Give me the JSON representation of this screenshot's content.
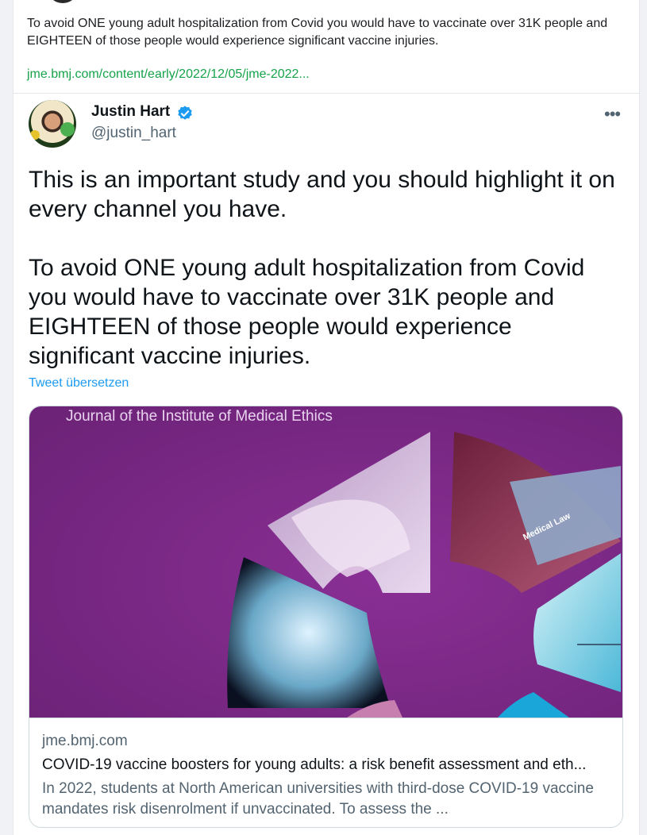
{
  "post": {
    "text": "To avoid ONE young adult hospitalization from Covid you would have to vaccinate over 31K people and EIGHTEEN of those people would experience significant vaccine injuries.",
    "link": "jme.bmj.com/content/early/2022/12/05/jme-2022..."
  },
  "tweet": {
    "author_name": "Justin Hart",
    "author_handle": "@justin_hart",
    "more_icon": "•••",
    "body": "This is an important study and you should highlight it on every channel you have.\n\nTo avoid ONE young adult hospitalization from Covid you would have to vaccinate over 31K people and EIGHTEEN of those people would experience significant vaccine injuries.",
    "translate_label": "Tweet übersetzen",
    "verified_color": "#1d9bf0"
  },
  "card": {
    "image_caption": "Journal of the Institute of Medical Ethics",
    "image_badge_text": "Medical Law",
    "domain": "jme.bmj.com",
    "title": "COVID-19 vaccine boosters for young adults: a risk benefit assessment and eth...",
    "description": "In 2022, students at North American universities with third-dose COVID-19 vaccine mandates risk disenrolment if unvaccinated. To assess the ..."
  },
  "colors": {
    "link_green": "#16a34a",
    "link_blue": "#1d9bf0",
    "card_purple": "#7a2a86"
  }
}
